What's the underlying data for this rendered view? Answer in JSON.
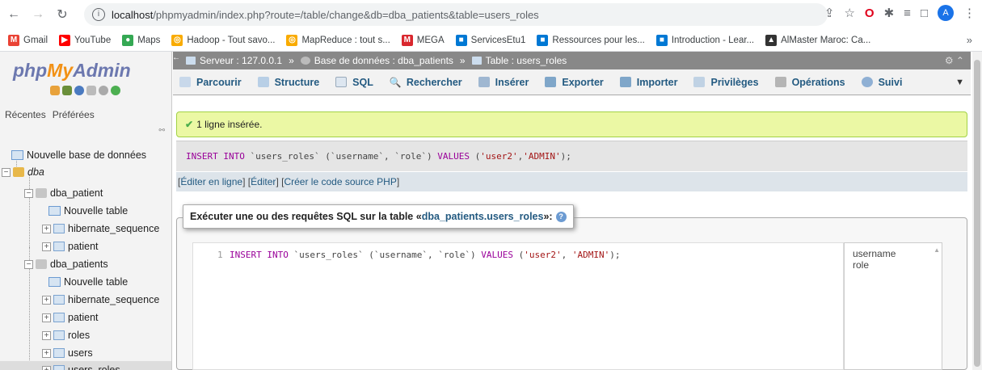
{
  "browser": {
    "url_host": "localhost",
    "url_path": "/phpmyadmin/index.php?route=/table/change&db=dba_patients&table=users_roles",
    "avatar_letter": "A",
    "bookmarks": [
      {
        "label": "Gmail",
        "color": "#ea4335",
        "glyph": "M"
      },
      {
        "label": "YouTube",
        "color": "#ff0000",
        "glyph": "▶"
      },
      {
        "label": "Maps",
        "color": "#34a853",
        "glyph": "●"
      },
      {
        "label": "Hadoop - Tout savo...",
        "color": "#f9ab00",
        "glyph": "◎"
      },
      {
        "label": "MapReduce : tout s...",
        "color": "#f9ab00",
        "glyph": "◎"
      },
      {
        "label": "MEGA",
        "color": "#d9272e",
        "glyph": "M"
      },
      {
        "label": "ServicesEtu1",
        "color": "#0078d4",
        "glyph": "■"
      },
      {
        "label": "Ressources pour les...",
        "color": "#0078d4",
        "glyph": "■"
      },
      {
        "label": "Introduction - Lear...",
        "color": "#0078d4",
        "glyph": "■"
      },
      {
        "label": "AlMaster Maroc: Ca...",
        "color": "#333333",
        "glyph": "▲"
      }
    ],
    "more": "»"
  },
  "sidebar": {
    "logo_php": "php",
    "logo_my": "My",
    "logo_admin": "Admin",
    "tab_recent": "Récentes",
    "tab_favorites": "Préférées",
    "tree": {
      "new_db": "Nouvelle base de données",
      "server_db": "dba",
      "db1": "dba_patient",
      "db1_new": "Nouvelle table",
      "db1_t1": "hibernate_sequence",
      "db1_t2": "patient",
      "db2": "dba_patients",
      "db2_new": "Nouvelle table",
      "db2_t1": "hibernate_sequence",
      "db2_t2": "patient",
      "db2_t3": "roles",
      "db2_t4": "users",
      "db2_t5": "users_roles"
    }
  },
  "breadcrumb": {
    "server": "Serveur : 127.0.0.1",
    "database": "Base de données : dba_patients",
    "table": "Table : users_roles",
    "sep": "»"
  },
  "menu": {
    "browse": "Parcourir",
    "structure": "Structure",
    "sql": "SQL",
    "search": "Rechercher",
    "insert": "Insérer",
    "export": "Exporter",
    "import": "Importer",
    "privileges": "Privilèges",
    "operations": "Opérations",
    "tracking": "Suivi"
  },
  "message": {
    "success": "1 ligne insérée."
  },
  "query": {
    "kw_insert": "INSERT INTO",
    "table": "`users_roles`",
    "cols": "(`username`, `role`)",
    "kw_values": "VALUES",
    "open": "(",
    "v1": "'user2'",
    "comma": ", ",
    "v2": "'ADMIN'",
    "close": ");"
  },
  "query_links": {
    "inline_edit": "Éditer en ligne",
    "edit": "Éditer",
    "php_code": "Créer le code source PHP"
  },
  "sql_panel": {
    "legend_prefix": "Exécuter une ou des requêtes SQL sur la table « ",
    "legend_table": "dba_patients.users_roles",
    "legend_suffix": " »:",
    "line_number": "1",
    "editor_text": "INSERT INTO `users_roles` (`username`, `role`) VALUES ('user2', 'ADMIN');",
    "columns": [
      "username",
      "role"
    ]
  }
}
